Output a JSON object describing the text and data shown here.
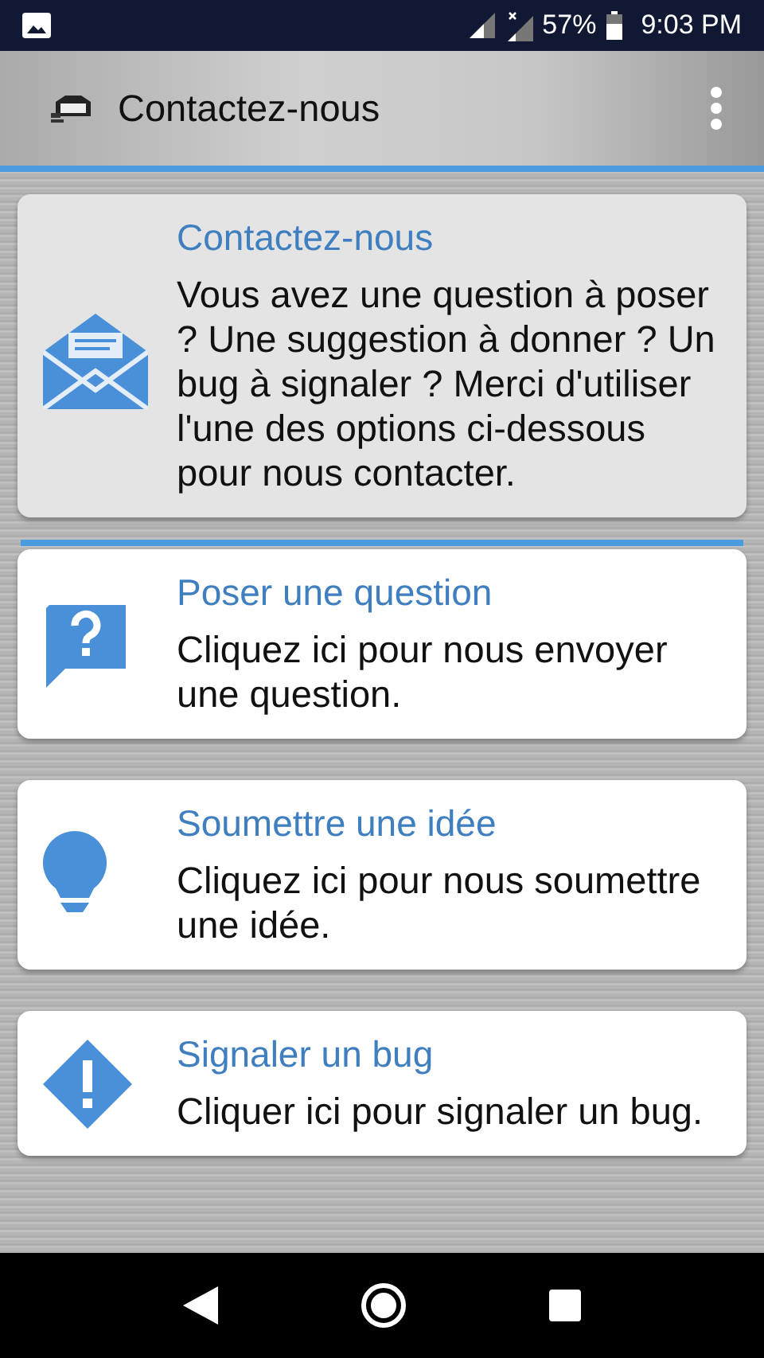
{
  "status_bar": {
    "battery": "57%",
    "time": "9:03 PM"
  },
  "app_bar": {
    "title": "Contactez-nous"
  },
  "intro": {
    "title": "Contactez-nous",
    "text": "Vous avez une question à poser ? Une suggestion à donner ? Un bug à signaler ? Merci d'utiliser l'une des options ci-dessous pour nous contacter."
  },
  "options": [
    {
      "kind": "question",
      "title": "Poser une question",
      "text": "Cliquez ici pour nous envoyer une question."
    },
    {
      "kind": "idea",
      "title": "Soumettre une idée",
      "text": "Cliquez ici pour nous soumettre une idée."
    },
    {
      "kind": "bug",
      "title": "Signaler un bug",
      "text": "Cliquer ici pour signaler un bug."
    }
  ]
}
